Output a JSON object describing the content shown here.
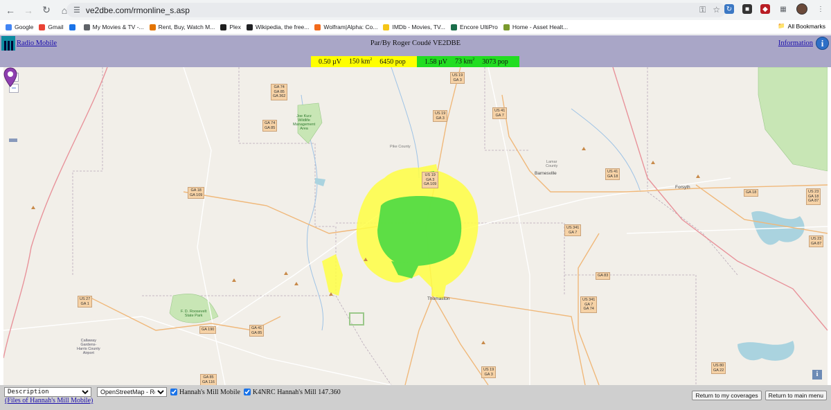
{
  "browser": {
    "url": "ve2dbe.com/rmonline_s.asp",
    "bookmarks": [
      {
        "label": "Google",
        "icon": "google-icon",
        "color": "#4285f4"
      },
      {
        "label": "Gmail",
        "icon": "gmail-icon",
        "color": "#ea4335"
      },
      {
        "label": "",
        "icon": "apps-grid-icon",
        "color": "#1a73e8"
      },
      {
        "label": "My Movies & TV -...",
        "icon": "movies-icon",
        "color": "#5f6368"
      },
      {
        "label": "Rent, Buy, Watch M...",
        "icon": "rent-icon",
        "color": "#e37400"
      },
      {
        "label": "Plex",
        "icon": "plex-icon",
        "color": "#1f1f1f"
      },
      {
        "label": "Wikipedia, the free...",
        "icon": "wikipedia-icon",
        "color": "#202124"
      },
      {
        "label": "Wolfram|Alpha: Co...",
        "icon": "wolfram-icon",
        "color": "#f26a1b"
      },
      {
        "label": "IMDb - Movies, TV...",
        "icon": "imdb-icon",
        "color": "#f5c518"
      },
      {
        "label": "Encore UltiPro",
        "icon": "ultipro-icon",
        "color": "#1b6e4a"
      },
      {
        "label": "Home - Asset Healt...",
        "icon": "asset-icon",
        "color": "#7a9a2e"
      }
    ],
    "all_bookmarks": "All Bookmarks"
  },
  "app": {
    "title": "Radio Mobile",
    "author": "Par/By Roger Coudé VE2DBE",
    "info": "Information",
    "info_glyph": "i"
  },
  "legend": {
    "yellow": {
      "field": "0.50 µV",
      "area_value": "150 km",
      "area_exp": "2",
      "pop": "6450 pop",
      "color": "#ffff00"
    },
    "green": {
      "field": "1.58 µV",
      "area_value": "73 km",
      "area_exp": "2",
      "pop": "3073 pop",
      "color": "#22dd22"
    }
  },
  "map": {
    "zoom_in": "+",
    "zoom_out": "−",
    "info_glyph": "i",
    "shields": [
      {
        "id": "ga74-85-362",
        "text": "GA 74\nGA 85\nGA 362"
      },
      {
        "id": "us19-ga3-top",
        "text": "US 19\nGA 3"
      },
      {
        "id": "us19-ga3-mid",
        "text": "US 19\nGA 3"
      },
      {
        "id": "us41-ga7-top",
        "text": "US 41\nGA 7"
      },
      {
        "id": "ga74-85",
        "text": "GA 74\nGA 85"
      },
      {
        "id": "us19-ga3-center",
        "text": "US 19\nGA 3\nGA 109"
      },
      {
        "id": "ga18-109",
        "text": "GA 18\nGA 109"
      },
      {
        "id": "us41-ga18",
        "text": "US 41\nGA 18"
      },
      {
        "id": "ga18-right",
        "text": "GA 18"
      },
      {
        "id": "us23-ga18-87",
        "text": "US 23\nGA 18\nGA 87"
      },
      {
        "id": "us341-ga7",
        "text": "US 341\nGA 7"
      },
      {
        "id": "us23-ga87",
        "text": "US 23\nGA 87"
      },
      {
        "id": "us27-ga1",
        "text": "US 27\nGA 1"
      },
      {
        "id": "ga83",
        "text": "GA 83"
      },
      {
        "id": "us341-ga7-74",
        "text": "US 341\nGA 7\nGA 74"
      },
      {
        "id": "ga190",
        "text": "GA 190"
      },
      {
        "id": "ga41-85",
        "text": "GA 41\nGA 85"
      },
      {
        "id": "ga85-116",
        "text": "GA 85\nGA 116"
      },
      {
        "id": "us19-ga3-bottom",
        "text": "US 19\nGA 3"
      },
      {
        "id": "us80-ga22",
        "text": "US 80\nGA 22"
      }
    ],
    "places": [
      {
        "id": "pike-county",
        "text": "Pike County"
      },
      {
        "id": "barnesville",
        "text": "Barnesville"
      },
      {
        "id": "forsyth",
        "text": "Forsyth"
      },
      {
        "id": "thomaston",
        "text": "Thomaston"
      },
      {
        "id": "lamar-county",
        "text": "Lamar\nCounty"
      },
      {
        "id": "joe-kurz",
        "text": "Joe Kurz\nWildlife\nManagement\nArea"
      },
      {
        "id": "fdr-park",
        "text": "F. D. Roosevelt\nState Park"
      },
      {
        "id": "callaway",
        "text": "Callaway\nGardens-\nHarris County\nAirport"
      }
    ]
  },
  "controls": {
    "description_select": "Description",
    "map_select": "OpenStreetMap - Road",
    "check1": "Hannah's Mill Mobile",
    "check2": "K4NRC Hannah's Mill 147.360",
    "files_link": "(Files of Hannah's Mill Mobile)",
    "btn_coverages": "Return to my coverages",
    "btn_main": "Return to main menu"
  }
}
